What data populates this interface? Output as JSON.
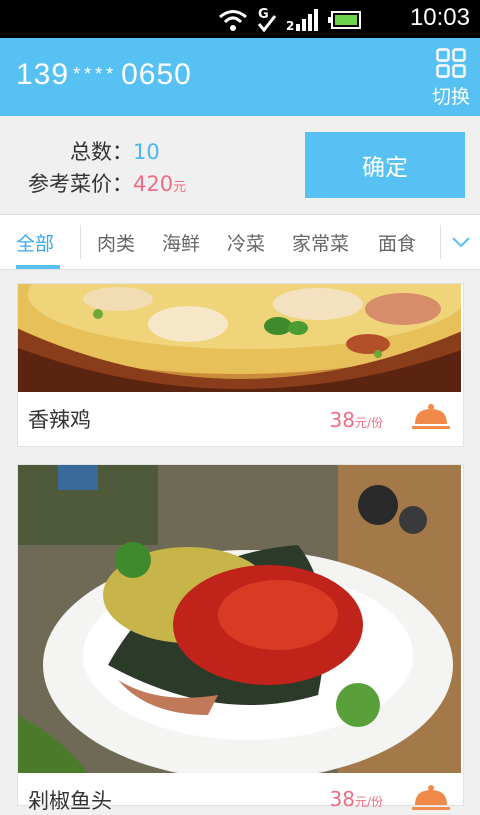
{
  "status_bar": {
    "time": "10:03",
    "icons": [
      "wifi-icon",
      "g-network-icon",
      "check-icon",
      "signal-icon",
      "battery-icon"
    ]
  },
  "header": {
    "phone_prefix": "139",
    "phone_mask": "****",
    "phone_suffix": "0650",
    "switch_label": "切换",
    "background": "#56c1f2"
  },
  "summary": {
    "count_label": "总数：",
    "count_value": "10",
    "price_label": "参考菜价：",
    "price_value": "420",
    "price_unit": "元",
    "confirm_label": "确定"
  },
  "tabs": [
    {
      "label": "全部",
      "active": true
    },
    {
      "label": "肉类"
    },
    {
      "label": "海鲜"
    },
    {
      "label": "冷菜"
    },
    {
      "label": "家常菜"
    },
    {
      "label": "面食"
    }
  ],
  "dishes": [
    {
      "name": "香辣鸡",
      "price": "38",
      "unit": "元/份"
    },
    {
      "name": "剁椒鱼头",
      "price": "38",
      "unit": "元/份"
    }
  ],
  "colors": {
    "accent": "#56c1f2",
    "price": "#ef6d84",
    "order_icon": "#f0894a"
  }
}
